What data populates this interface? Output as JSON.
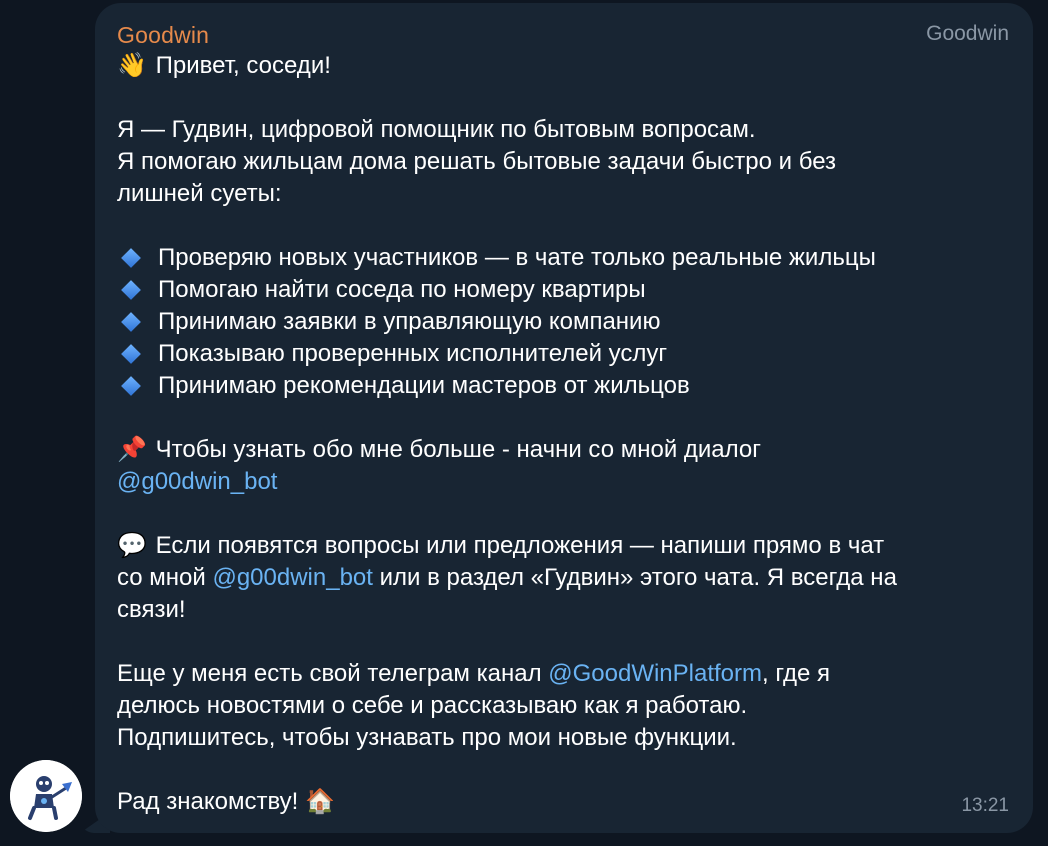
{
  "message": {
    "sender_name": "Goodwin",
    "author_tag": "Goodwin",
    "time": "13:21",
    "greeting_emoji": "👋",
    "greeting": " Привет, соседи!",
    "intro_1": "Я — Гудвин, цифровой помощник по бытовым вопросам.",
    "intro_2": "Я помогаю жильцам дома решать бытовые задачи быстро и без",
    "intro_3": "лишней суеты:",
    "features": [
      "Проверяю новых участников — в чате только реальные жильцы",
      "Помогаю найти соседа по номеру квартиры",
      "Принимаю заявки в управляющую компанию",
      "Показываю проверенных исполнителей услуг",
      "Принимаю рекомендации мастеров от жильцов"
    ],
    "pin_emoji": "📌",
    "dialog_text": " Чтобы узнать обо мне больше - начни со мной диалог",
    "bot_link": "@g00dwin_bot",
    "speech_emoji": "💬",
    "questions_1": " Если появятся вопросы или предложения — напиши прямо в чат",
    "questions_2a": "со мной ",
    "questions_2b": " или в раздел «Гудвин» этого чата. Я всегда на",
    "questions_3": "связи!",
    "channel_1a": "Еще у меня есть свой телеграм канал ",
    "channel_link": "@GoodWinPlatform",
    "channel_1b": ", где я",
    "channel_2": "делюсь новостями о себе и рассказываю как я работаю.",
    "channel_3": "Подпишитесь, чтобы узнавать про мои новые функции.",
    "closing": "Рад знакомству! ",
    "house_emoji": "🏠"
  }
}
